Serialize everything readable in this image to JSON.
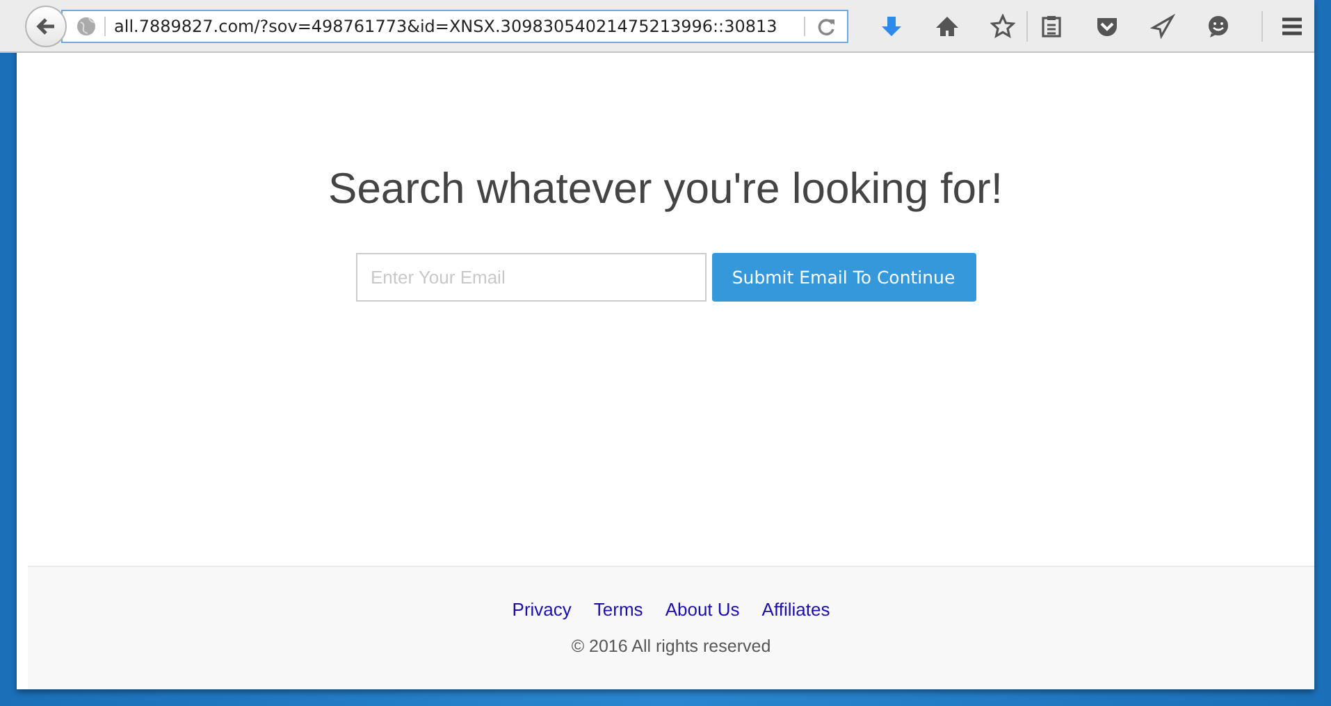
{
  "toolbar": {
    "url": "all.7889827.com/?sov=498761773&id=XNSX.30983054021475213996::30813"
  },
  "hero": {
    "heading": "Search whatever you're looking for!",
    "email_field": {
      "placeholder": "Enter Your Email"
    },
    "submit_button": "Submit Email To Continue"
  },
  "footer": {
    "links": [
      "Privacy",
      "Terms",
      "About Us",
      "Affiliates"
    ],
    "copyright": "© 2016 All rights reserved"
  }
}
